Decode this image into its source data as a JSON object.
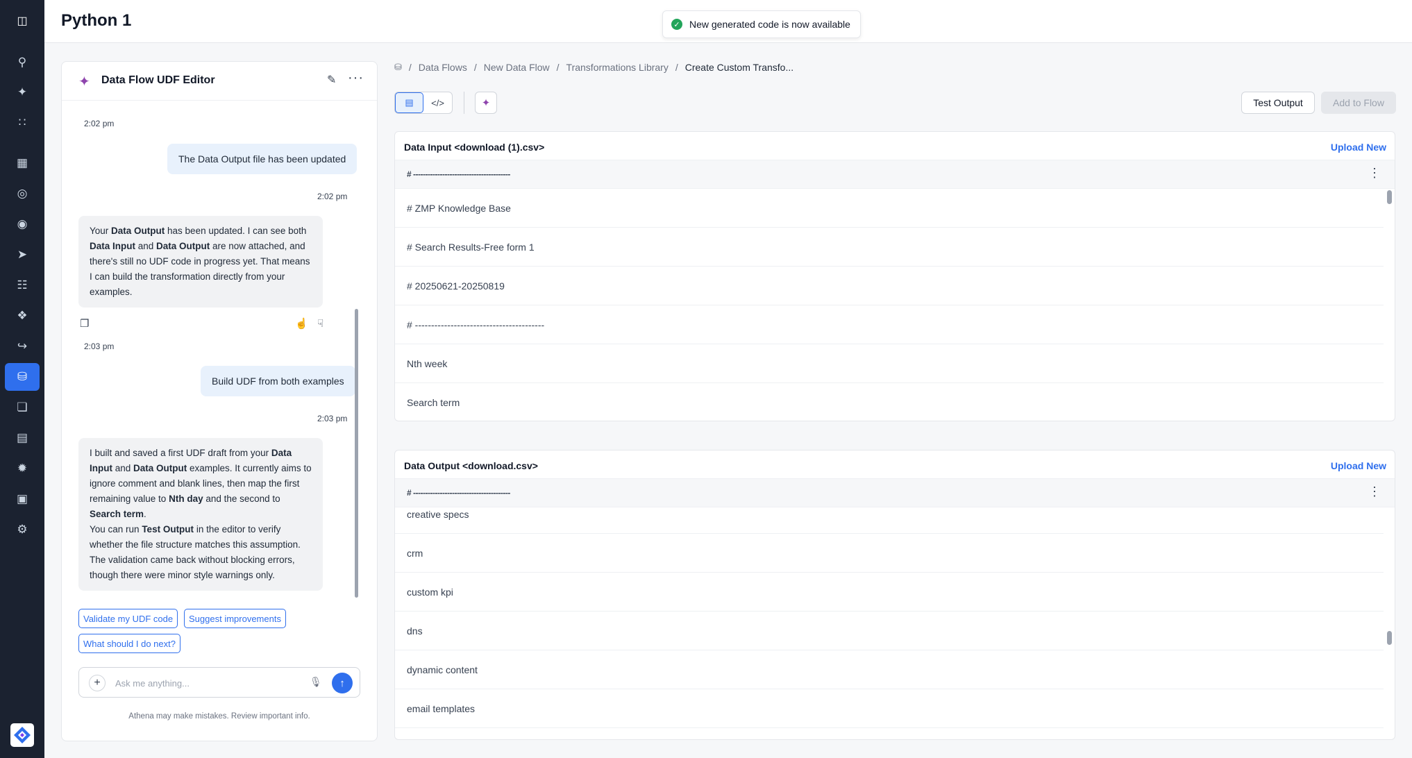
{
  "header": {
    "title": "Python 1",
    "toast": "New generated code is now available"
  },
  "rail": {
    "icons": [
      "panel-toggle-icon",
      "search-icon",
      "sparkle-icon",
      "apps-grid-icon",
      "dashboard-icon",
      "compass-icon",
      "target-icon",
      "send-icon",
      "hierarchy-icon",
      "modules-icon",
      "pipeline-icon",
      "database-icon",
      "library-icon",
      "document-icon",
      "automation-icon",
      "calendar-icon",
      "settings-icon"
    ],
    "active": "database-icon"
  },
  "chat": {
    "title": "Data Flow UDF Editor",
    "messages": {
      "ts1": "2:02 pm",
      "user1": "The Data Output file has been updated",
      "ts2": "2:02 pm",
      "bot1": [
        {
          "t": "Your "
        },
        {
          "b": "Data Output"
        },
        {
          "t": " has been updated. I can see both "
        },
        {
          "b": "Data Input"
        },
        {
          "t": " and "
        },
        {
          "b": "Data Output"
        },
        {
          "t": " are now attached, and there's still no UDF code in progress yet. That means I can build the transformation directly from your examples."
        }
      ],
      "ts3": "2:03 pm",
      "user2": "Build UDF from both examples",
      "ts4": "2:03 pm",
      "bot2": [
        {
          "t": "I built and saved a first UDF draft from your "
        },
        {
          "b": "Data Input"
        },
        {
          "t": " and "
        },
        {
          "b": "Data Output"
        },
        {
          "t": " examples. It currently aims to ignore comment and blank lines, then map the first remaining value to "
        },
        {
          "b": "Nth day"
        },
        {
          "t": " and the second to "
        },
        {
          "b": "Search term"
        },
        {
          "t": "."
        },
        {
          "br": true
        },
        {
          "t": "You can run "
        },
        {
          "b": "Test Output"
        },
        {
          "t": " in the editor to verify whether the file structure matches this assumption. The validation came back without blocking errors, though there were minor style warnings only."
        }
      ]
    },
    "suggestions": [
      "Validate my UDF code",
      "Suggest improvements",
      "What should I do next?"
    ],
    "input_placeholder": "Ask me anything...",
    "disclaimer": "Athena may make mistakes. Review important info."
  },
  "breadcrumb": [
    "Data Flows",
    "New Data Flow",
    "Transformations Library",
    "Create Custom Transfo..."
  ],
  "toolbar": {
    "test_label": "Test Output",
    "add_label": "Add to Flow"
  },
  "input_panel": {
    "title": "Data Input <download (1).csv>",
    "upload_label": "Upload New",
    "header_line": "# ----------------------------------------",
    "rows": [
      "# ZMP Knowledge Base",
      "# Search Results-Free form 1",
      "# 20250621-20250819",
      "# ----------------------------------------",
      "Nth week",
      "Search term"
    ]
  },
  "output_panel": {
    "title": "Data Output <download.csv>",
    "upload_label": "Upload New",
    "header_line": "# ----------------------------------------",
    "rows": [
      "creative specs",
      "crm",
      "custom kpi",
      "dns",
      "dynamic content",
      "email templates"
    ]
  }
}
